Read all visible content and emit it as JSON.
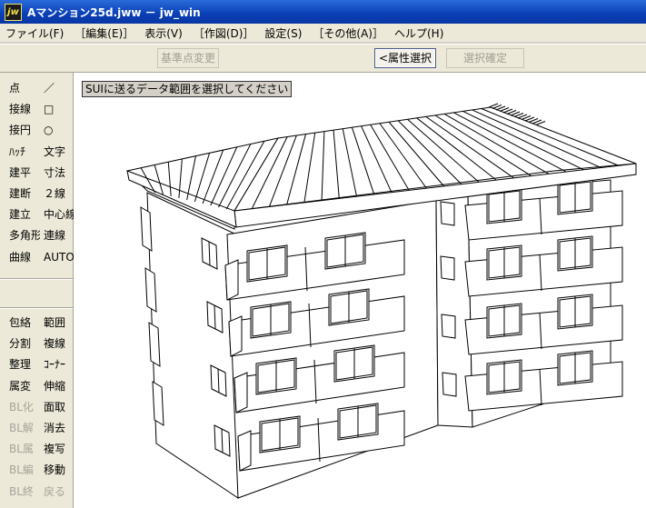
{
  "window": {
    "icon_text": "jw",
    "title": "Aマンション25d.jww － jw_win"
  },
  "menu": [
    "ファイル(F)",
    "［編集(E)］",
    "表示(V)",
    "［作図(D)］",
    "設定(S)",
    "［その他(A)］",
    "ヘルプ(H)"
  ],
  "toolbar": {
    "base_point": "基準点変更",
    "attr_select": "<属性選択>",
    "select_confirm": "選択確定"
  },
  "sidebar": {
    "group1": [
      [
        "点",
        "／"
      ],
      [
        "接線",
        "□"
      ],
      [
        "接円",
        "○"
      ],
      [
        "ﾊｯﾁ",
        "文字"
      ],
      [
        "建平",
        "寸法"
      ],
      [
        "建断",
        "２線"
      ],
      [
        "建立",
        "中心線"
      ],
      [
        "多角形",
        "連線"
      ],
      [
        "曲線",
        "AUTO"
      ]
    ],
    "group2": [
      [
        "包絡",
        "範囲"
      ],
      [
        "分割",
        "複線"
      ],
      [
        "整理",
        "ｺｰﾅｰ"
      ],
      [
        "属変",
        "伸縮"
      ],
      [
        "BL化",
        "面取"
      ],
      [
        "BL解",
        "消去"
      ],
      [
        "BL属",
        "複写"
      ],
      [
        "BL編",
        "移動"
      ],
      [
        "BL終",
        "戻る"
      ]
    ],
    "disabled_left": [
      "BL化",
      "BL解",
      "BL属",
      "BL編",
      "BL終"
    ],
    "disabled_right": [
      "戻る"
    ]
  },
  "canvas": {
    "status_message": "SUIに送るデータ範囲を選択してください"
  },
  "colors": {
    "titlebar": "#0a3fb6",
    "canvas": "#ffffff",
    "chrome": "#ece9d8"
  }
}
